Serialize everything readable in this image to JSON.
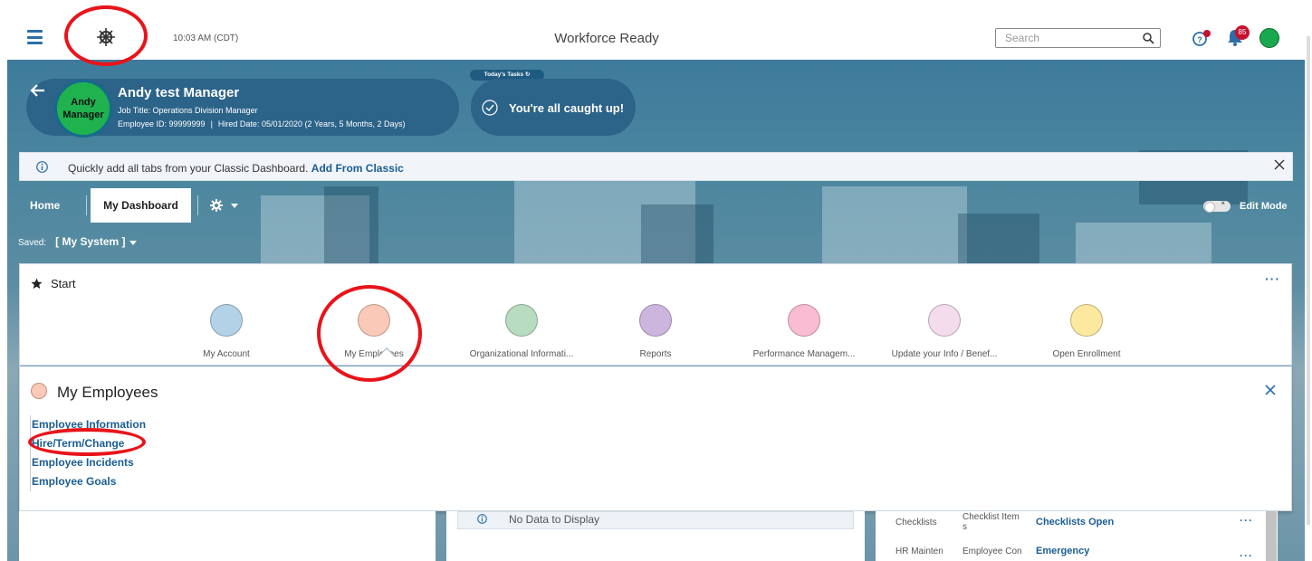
{
  "topbar": {
    "time": "10:03 AM (CDT)",
    "app_title": "Workforce Ready",
    "search_placeholder": "Search",
    "notification_count": "85"
  },
  "employee": {
    "initials_line1": "Andy",
    "initials_line2": "Manager",
    "name": "Andy test Manager",
    "job_title": "Job Title: Operations Division Manager",
    "employee_id": "Employee ID: 99999999",
    "separator": "|",
    "hired_date": "Hired Date: 05/01/2020 (2 Years, 5 Months, 2 Days)"
  },
  "tasks": {
    "tab_label": "Today's Tasks",
    "status": "You're all caught up!"
  },
  "banner": {
    "text": "Quickly add all tabs from your Classic Dashboard.",
    "link": "Add From Classic"
  },
  "tabs": {
    "home": "Home",
    "my_dashboard": "My Dashboard",
    "edit_mode": "Edit Mode"
  },
  "saved": {
    "label": "Saved:",
    "value": "[ My System ]"
  },
  "start": {
    "title": "Start",
    "apps": [
      {
        "label": "My Account",
        "color": "#b3d2e8"
      },
      {
        "label": "My Employees",
        "color": "#fbc9b8"
      },
      {
        "label": "Organizational Informati...",
        "color": "#b7dcc0"
      },
      {
        "label": "Reports",
        "color": "#cdb6de"
      },
      {
        "label": "Performance Managem...",
        "color": "#f9bcd3"
      },
      {
        "label": "Update your Info / Benef...",
        "color": "#f3dcec"
      },
      {
        "label": "Open Enrollment",
        "color": "#fde8a0"
      }
    ]
  },
  "my_employees": {
    "title": "My Employees",
    "links": [
      "Employee Information",
      "Hire/Term/Change",
      "Employee Incidents",
      "Employee Goals"
    ]
  },
  "widgets": {
    "no_data": "No Data to Display",
    "rows": [
      {
        "col1": "Checklists",
        "col2a": "Checklist Item",
        "col2b": "s",
        "link": "Checklists Open"
      },
      {
        "col1": "HR Mainten",
        "col2a": "Employee Con",
        "col2b": "",
        "link": "Emergency"
      }
    ]
  }
}
